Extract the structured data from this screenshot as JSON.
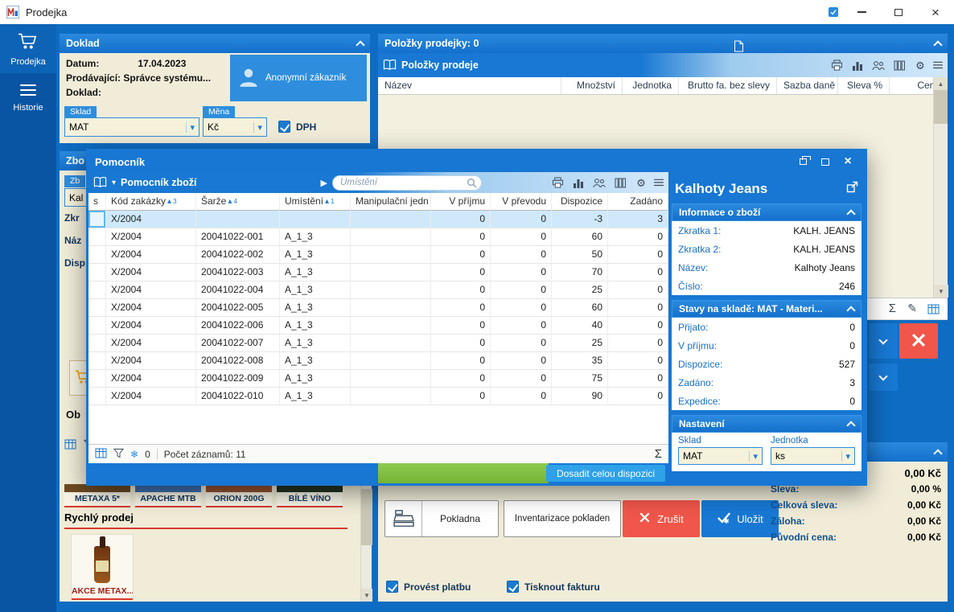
{
  "titlebar": {
    "title": "Prodejka"
  },
  "sidebar": {
    "items": [
      {
        "label": "Prodejka"
      },
      {
        "label": "Historie"
      }
    ]
  },
  "doklad": {
    "header": "Doklad",
    "datum_label": "Datum:",
    "datum_value": "17.04.2023",
    "prodavajici_label": "Prodávající:",
    "prodavajici_value": "Správce systému...",
    "doklad_label": "Doklad:",
    "customer_button": "Anonymní zákazník",
    "sklad_tag": "Sklad",
    "sklad_value": "MAT",
    "mena_tag": "Měna",
    "mena_value": "Kč",
    "dph_label": "DPH"
  },
  "zbozi_panel": {
    "header_partial": "Zbo",
    "tag_partial": "Zb",
    "combo_partial": "Kal",
    "label1_partial": "Zkr",
    "label2_partial": "Náz",
    "label3_partial": "Disp",
    "label4_partial": "Ob",
    "products": [
      "METAXA 5*",
      "APACHE MTB",
      "ORION 200G",
      "BÍLÉ VÍNO"
    ],
    "quick_sale_title": "Rychlý prodej",
    "quick_tile_label": "AKCE METAX..."
  },
  "polozky": {
    "header": "Položky prodejky: 0",
    "toolbar_title": "Položky prodeje",
    "columns": [
      "Název",
      "Množství",
      "Jednotka",
      "Brutto fa. bez slevy",
      "Sazba daně",
      "Sleva %",
      "Cena"
    ]
  },
  "helper": {
    "title": "Pomocník",
    "toolbar_title": "Pomocník zboží",
    "search_placeholder": "Umístění",
    "columns": [
      {
        "label": "s"
      },
      {
        "label": "Kód zakázky",
        "sort": "3"
      },
      {
        "label": "Šarže",
        "sort": "4"
      },
      {
        "label": "Umístění",
        "sort": "1"
      },
      {
        "label": "Manipulační jedn"
      },
      {
        "label": "V příjmu"
      },
      {
        "label": "V převodu"
      },
      {
        "label": "Dispozice"
      },
      {
        "label": "Zadáno"
      }
    ],
    "rows": [
      [
        "X/2004",
        "",
        "",
        "",
        "0",
        "0",
        "-3",
        "3"
      ],
      [
        "X/2004",
        "20041022-001",
        "A_1_3",
        "",
        "0",
        "0",
        "60",
        "0"
      ],
      [
        "X/2004",
        "20041022-002",
        "A_1_3",
        "",
        "0",
        "0",
        "50",
        "0"
      ],
      [
        "X/2004",
        "20041022-003",
        "A_1_3",
        "",
        "0",
        "0",
        "70",
        "0"
      ],
      [
        "X/2004",
        "20041022-004",
        "A_1_3",
        "",
        "0",
        "0",
        "25",
        "0"
      ],
      [
        "X/2004",
        "20041022-005",
        "A_1_3",
        "",
        "0",
        "0",
        "60",
        "0"
      ],
      [
        "X/2004",
        "20041022-006",
        "A_1_3",
        "",
        "0",
        "0",
        "40",
        "0"
      ],
      [
        "X/2004",
        "20041022-007",
        "A_1_3",
        "",
        "0",
        "0",
        "25",
        "0"
      ],
      [
        "X/2004",
        "20041022-008",
        "A_1_3",
        "",
        "0",
        "0",
        "35",
        "0"
      ],
      [
        "X/2004",
        "20041022-009",
        "A_1_3",
        "",
        "0",
        "0",
        "75",
        "0"
      ],
      [
        "X/2004",
        "20041022-010",
        "A_1_3",
        "",
        "0",
        "0",
        "90",
        "0"
      ]
    ],
    "footer_badge": "0",
    "footer_count": "Počet záznamů: 11",
    "apply_button": "Dosadit celou dispozici"
  },
  "detail": {
    "title": "Kalhoty Jeans",
    "info": {
      "header": "Informace o zboží",
      "rows": [
        [
          "Zkratka 1:",
          "KALH. JEANS"
        ],
        [
          "Zkratka 2:",
          "KALH. JEANS"
        ],
        [
          "Název:",
          "Kalhoty Jeans"
        ],
        [
          "Číslo:",
          "246"
        ]
      ]
    },
    "stock": {
      "header": "Stavy na skladě: MAT - Materi...",
      "rows": [
        [
          "Přijato:",
          "0"
        ],
        [
          "V příjmu:",
          "0"
        ],
        [
          "Dispozice:",
          "527"
        ],
        [
          "Zadáno:",
          "3"
        ],
        [
          "Expedice:",
          "0"
        ]
      ]
    },
    "settings": {
      "header": "Nastavení",
      "sklad_label": "Sklad",
      "sklad_value": "MAT",
      "jednotka_label": "Jednotka",
      "jednotka_value": "ks"
    }
  },
  "actions": {
    "pokladna": "Pokladna",
    "inventarizace": "Inventarizace pokladen",
    "zrusit": "Zrušit",
    "ulozit": "Uložit"
  },
  "payment": {
    "provest_platbu": "Provést platbu",
    "tisknout_fakturu": "Tisknout fakturu"
  },
  "totals": {
    "total_value": "0,00 Kč",
    "rows": [
      [
        "Sleva:",
        "0,00 %"
      ],
      [
        "Celková sleva:",
        "0,00 Kč"
      ],
      [
        "Záloha:",
        "0,00 Kč"
      ],
      [
        "Původní cena:",
        "0,00 Kč"
      ]
    ]
  },
  "icons": {
    "dropdown": "▾",
    "sort_arrow": "▴",
    "play": "▶",
    "sigma": "Σ",
    "pencil": "✎",
    "gear": "⚙",
    "snowflake": "❄",
    "close": "×",
    "scroll_up": "▲",
    "scroll_down": "▼"
  },
  "colors": {
    "accent": "#1a7ad2",
    "header_blue": "#1878d3",
    "red": "#f0564a",
    "green": "#7fbf3f",
    "cream": "#f0ecd8",
    "sidebar": "#0a55a3"
  }
}
